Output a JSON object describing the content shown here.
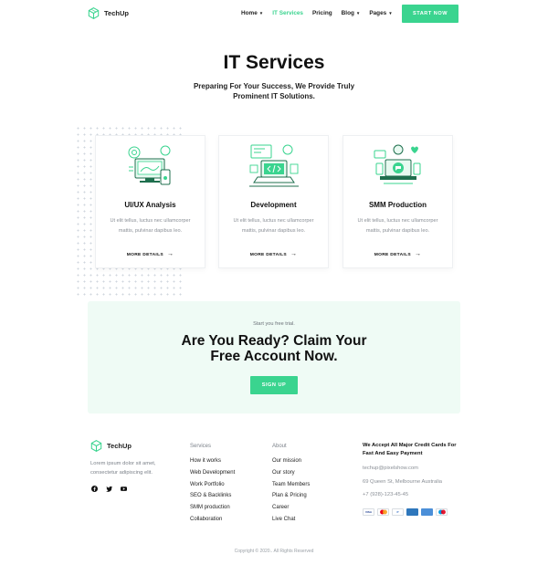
{
  "header": {
    "brand": "TechUp",
    "nav": [
      {
        "label": "Home",
        "caret": true,
        "active": false
      },
      {
        "label": "IT Services",
        "caret": false,
        "active": true
      },
      {
        "label": "Pricing",
        "caret": false,
        "active": false
      },
      {
        "label": "Blog",
        "caret": true,
        "active": false
      },
      {
        "label": "Pages",
        "caret": true,
        "active": false
      }
    ],
    "cta": "START NOW"
  },
  "hero": {
    "title": "IT Services",
    "subtitle": "Preparing For Your Success, We Provide Truly Prominent IT Solutions."
  },
  "cards": [
    {
      "icon": "ui-ux-icon",
      "title": "UI/UX Analysis",
      "desc": "Ut elit tellus, luctus nec ullamcorper mattis, pulvinar dapibus leo.",
      "link": "MORE DETAILS"
    },
    {
      "icon": "development-icon",
      "title": "Development",
      "desc": "Ut elit tellus, luctus nec ullamcorper mattis, pulvinar dapibus leo.",
      "link": "MORE DETAILS"
    },
    {
      "icon": "smm-icon",
      "title": "SMM Production",
      "desc": "Ut elit tellus, luctus nec ullamcorper mattis, pulvinar dapibus leo.",
      "link": "MORE DETAILS"
    }
  ],
  "cta": {
    "small": "Start you free trial.",
    "title": "Are You Ready? Claim Your Free Account Now.",
    "button": "SIGN UP"
  },
  "footer": {
    "brand": "TechUp",
    "desc": "Lorem ipsum dolor sit amet, consectetur adipiscing elit.",
    "services": {
      "heading": "Services",
      "links": [
        "How it works",
        "Web Development",
        "Work Portfolio",
        "SEO & Backlinks",
        "SMM production",
        "Collaboration"
      ]
    },
    "about": {
      "heading": "About",
      "links": [
        "Our mission",
        "Our story",
        "Team Members",
        "Plan & Pricing",
        "Career",
        "Live Chat"
      ]
    },
    "payments": {
      "heading": "We Accept All Major Credit Cards For Fast And Easy Payment",
      "email": "techup@pixelshow.com",
      "address": "69 Queen St, Melbourne Australia",
      "phone": "+7 (928)-123-45-45",
      "cards": [
        "VISA",
        "MC",
        "PP",
        "AMEX",
        "DISC",
        "MAES"
      ]
    },
    "copyright": "Copyright © 2020.. All Rights Reserved"
  },
  "colors": {
    "accent": "#3ad48f",
    "cta_bg": "#effbf5"
  }
}
